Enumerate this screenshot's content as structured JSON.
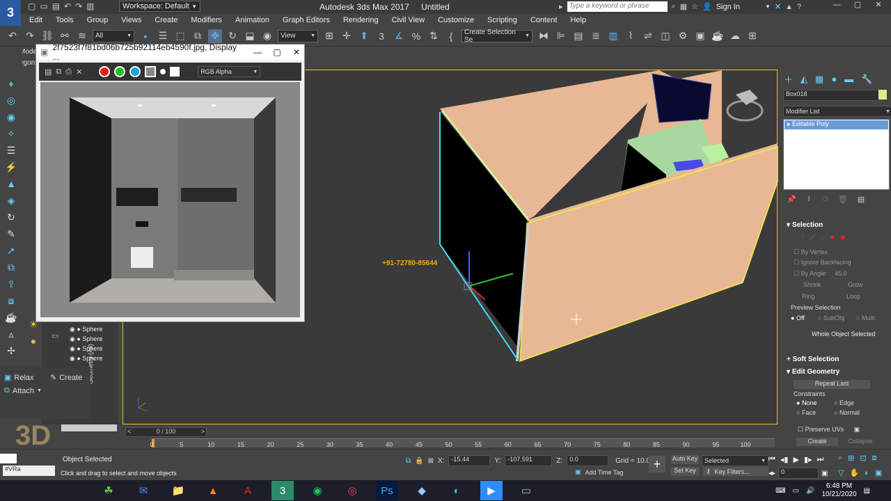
{
  "title_bar": {
    "workspace_label": "Workspace: Default",
    "app_title": "Autodesk 3ds Max 2017",
    "doc_title": "Untitled",
    "search_placeholder": "Type a keyword or phrase",
    "sign_in": "Sign In"
  },
  "menu": [
    "Edit",
    "Tools",
    "Group",
    "Views",
    "Create",
    "Modifiers",
    "Animation",
    "Graph Editors",
    "Rendering",
    "Civil View",
    "Customize",
    "Scripting",
    "Content",
    "Help"
  ],
  "toolbar": {
    "filter": "All",
    "view": "View",
    "selection_set": "Create Selection Se"
  },
  "ribbon_tabs": [
    "Mode",
    "Polygon"
  ],
  "dialog": {
    "title": "2f7523f7f81bd06b725b92114eb4590f.jpg, Display ...",
    "channel": "RGB Alpha"
  },
  "scene_list": {
    "items": [
      "Sphere",
      "Sphere",
      "Sphere",
      "Sphere"
    ],
    "side_label": "Geometry (All)"
  },
  "left_panel": {
    "relax": "Relax",
    "create": "Create",
    "attach": "Attach"
  },
  "viewport": {
    "phone_text": "+91-72780-85644"
  },
  "command_panel": {
    "object_name": "Box018",
    "modifier_list": "Modifier List",
    "stack_item": "Editable Poly",
    "selection_header": "Selection",
    "by_vertex": "By Vertex",
    "ignore_backfacing": "Ignore Backfacing",
    "by_angle": "By Angle:",
    "angle_value": "45.0",
    "shrink": "Shrink",
    "grow": "Grow",
    "ring": "Ring",
    "loop": "Loop",
    "preview_selection": "Preview Selection",
    "off": "Off",
    "subobj": "SubObj",
    "multi": "Multi",
    "whole_object": "Whole Object Selected",
    "soft_selection": "Soft Selection",
    "edit_geometry": "Edit Geometry",
    "repeat_last": "Repeat Last",
    "constraints": "Constraints",
    "none": "None",
    "edge": "Edge",
    "face": "Face",
    "normal": "Normal",
    "preserve_uvs": "Preserve UVs",
    "create_btn": "Create",
    "collapse_btn": "Collapse"
  },
  "timeline": {
    "frame": "0 / 100",
    "ticks": [
      "0",
      "5",
      "10",
      "15",
      "20",
      "25",
      "30",
      "35",
      "40",
      "45",
      "50",
      "55",
      "60",
      "65",
      "70",
      "75",
      "80",
      "85",
      "90",
      "95",
      "100"
    ]
  },
  "status": {
    "selected": "Object Selected",
    "prompt": "Click and drag to select and move objects",
    "x_label": "X:",
    "x_value": "-15.44",
    "y_label": "Y:",
    "y_value": "-107.591",
    "z_label": "Z:",
    "z_value": "0.0",
    "grid": "Grid = 10.0",
    "add_time_tag": "Add Time Tag",
    "auto_key": "Auto Key",
    "set_key": "Set Key",
    "selected_dropdown": "Selected",
    "key_filters": "Key Filters...",
    "frame_field": "0",
    "vray_tab": "#VRa"
  },
  "taskbar": {
    "time": "6:48 PM",
    "date": "10/21/2020"
  },
  "colors": {
    "accent_blue": "#5ab0ff",
    "viewport_border": "#e8c030",
    "wall_color": "#e8b894",
    "selection_cyan": "#40e0f0",
    "phone_text": "#ffaa00"
  }
}
